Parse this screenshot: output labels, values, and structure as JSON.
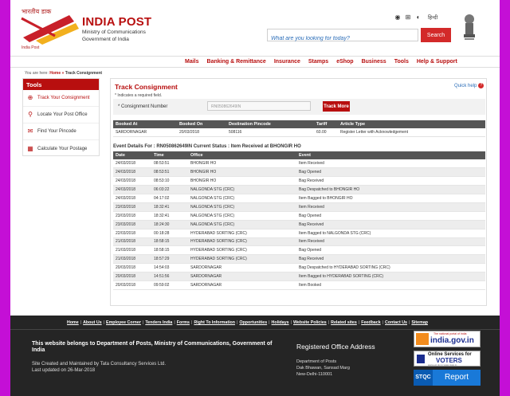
{
  "header": {
    "logo_hindi": "भारतीय डाक",
    "logo_eng": "India Post",
    "brand_title": "INDIA POST",
    "brand_sub1": "Ministry of Communications",
    "brand_sub2": "Government of India",
    "search_placeholder": "What are you looking for today?",
    "search_button": "Search",
    "hindi_link": "हिन्दी"
  },
  "nav": {
    "items": [
      "Mails",
      "Banking & Remittance",
      "Insurance",
      "Stamps",
      "eShop",
      "Business",
      "Tools",
      "Help & Support"
    ]
  },
  "breadcrumb": {
    "prefix": "You are here:",
    "home": "Home",
    "arrow": "»",
    "current": "Track Consignment"
  },
  "sidebar": {
    "title": "Tools",
    "items": [
      {
        "label": "Track Your Consignment",
        "icon": "target-icon"
      },
      {
        "label": "Locate Your Post Office",
        "icon": "location-pin-icon"
      },
      {
        "label": "Find Your Pincode",
        "icon": "envelope-icon"
      },
      {
        "label": "Calculate Your Postage",
        "icon": "calculator-icon"
      }
    ]
  },
  "main": {
    "title": "Track Consignment",
    "quick_help": "Quick help",
    "req_note": "* Indicates a required field.",
    "consignment_label": "* Consignment Number",
    "consignment_value": "RN050862649IN",
    "track_button": "Track More",
    "booking_headers": [
      "Booked At",
      "Booked On",
      "Destination Pincode",
      "Tariff",
      "Article Type"
    ],
    "booking_row": [
      "SARDORNAGAR",
      "20/03/2018",
      "508116",
      "60.00",
      "Register Letter with Acknowledgement"
    ],
    "event_heading": "Event Details For : RN050862649IN   Current Status : Item Received at BHONGIR HO",
    "event_headers": [
      "Date",
      "Time",
      "Office",
      "Event"
    ],
    "events": [
      [
        "24/03/2018",
        "08:53:51",
        "BHONGIR HO",
        "Item Received"
      ],
      [
        "24/03/2018",
        "08:53:51",
        "BHONGIR HO",
        "Bag Opened"
      ],
      [
        "24/03/2018",
        "08:53:10",
        "BHONGIR HO",
        "Bag Received"
      ],
      [
        "24/03/2018",
        "06:03:22",
        "NALGONDA STG (CRC)",
        "Bag Despatched to BHONGIR HO"
      ],
      [
        "24/03/2018",
        "04:17:02",
        "NALGONDA STG (CRC)",
        "Item Bagged to BHONGIR HO"
      ],
      [
        "23/03/2018",
        "18:32:41",
        "NALGONDA STG (CRC)",
        "Item Received"
      ],
      [
        "23/03/2018",
        "18:32:41",
        "NALGONDA STG (CRC)",
        "Bag Opened"
      ],
      [
        "23/03/2018",
        "18:24:30",
        "NALGONDA STG (CRC)",
        "Bag Received"
      ],
      [
        "22/03/2018",
        "00:18:28",
        "HYDERABAD SORTING (CRC)",
        "Item Bagged to NALGONDA STG (CRC)"
      ],
      [
        "21/03/2018",
        "18:58:15",
        "HYDERABAD SORTING (CRC)",
        "Item Received"
      ],
      [
        "21/03/2018",
        "18:58:15",
        "HYDERABAD SORTING (CRC)",
        "Bag Opened"
      ],
      [
        "21/03/2018",
        "18:57:29",
        "HYDERABAD SORTING (CRC)",
        "Bag Received"
      ],
      [
        "20/03/2018",
        "14:54:03",
        "SARDORNAGAR",
        "Bag Despatched to HYDERABAD SORTING (CRC)"
      ],
      [
        "20/03/2018",
        "14:51:56",
        "SARDORNAGAR",
        "Item Bagged to HYDERABAD SORTING (CRC)"
      ],
      [
        "20/03/2018",
        "09:59:02",
        "SARDORNAGAR",
        "Item Booked"
      ]
    ]
  },
  "footer": {
    "links": [
      "Home",
      "About Us",
      "Employee Corner",
      "Tenders India",
      "Forms",
      "Right To Information",
      "Opportunities",
      "Holidays",
      "Website Policies",
      "Related sites",
      "Feedback",
      "Contact Us",
      "Sitemap"
    ],
    "owner": "This website belongs to Department of Posts, Ministry of Communications, Government of India",
    "maint1": "Site Created and Maintained by Tata Consultancy Services Ltd.",
    "maint2": "Last updated on  26-Mar-2018",
    "reg_title": "Registered Office Address",
    "reg_addr1": "Department of Posts",
    "reg_addr2": "Dak Bhawan, Sansad Marg",
    "reg_addr3": "New-Delhi-110001",
    "india_gov_tag": "The national portal of India",
    "india_gov_text": "india.gov.in",
    "voters_line1": "Online Services for",
    "voters_line2": "VOTERS",
    "voters_url": "www.eci.nic.in  www.nvsp.in",
    "stqc": "STQC",
    "report": "Report"
  },
  "colors": {
    "brand_red": "#b80f0f",
    "search_red": "#d32a2a",
    "footer_bg": "#252525",
    "page_bg": "#c40fd6"
  }
}
